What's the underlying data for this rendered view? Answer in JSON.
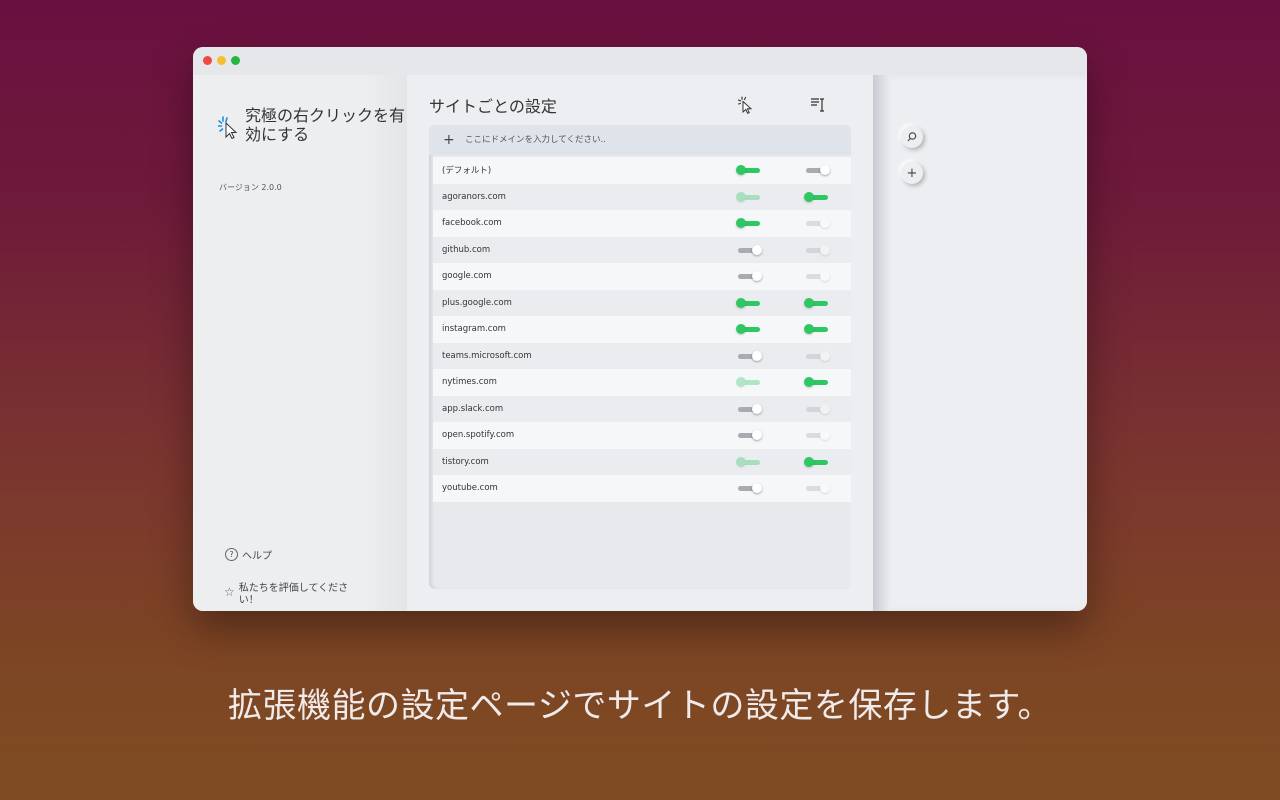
{
  "app": {
    "title": "究極の右クリックを有効にする",
    "version": "バージョン 2.0.0"
  },
  "sidebar": {
    "help_label": "ヘルプ",
    "help_icon": "?",
    "rate_label": "私たちを評価してください！",
    "rate_icon": "☆"
  },
  "main": {
    "title": "サイトごとの設定",
    "column_icons": [
      "cursor-click-icon",
      "text-select-icon"
    ],
    "add_placeholder": "ここにドメインを入力してください..",
    "add_icon": "+",
    "sites": [
      {
        "domain": "(デフォルト)",
        "toggle1": "on",
        "toggle2": "off"
      },
      {
        "domain": "agoranors.com",
        "toggle1": "on-dim",
        "toggle2": "on"
      },
      {
        "domain": "facebook.com",
        "toggle1": "on",
        "toggle2": "off-dim"
      },
      {
        "domain": "github.com",
        "toggle1": "off",
        "toggle2": "off-dim"
      },
      {
        "domain": "google.com",
        "toggle1": "off",
        "toggle2": "off-dim"
      },
      {
        "domain": "plus.google.com",
        "toggle1": "on",
        "toggle2": "on"
      },
      {
        "domain": "instagram.com",
        "toggle1": "on",
        "toggle2": "on"
      },
      {
        "domain": "teams.microsoft.com",
        "toggle1": "off",
        "toggle2": "off-dim"
      },
      {
        "domain": "nytimes.com",
        "toggle1": "on-dim",
        "toggle2": "on"
      },
      {
        "domain": "app.slack.com",
        "toggle1": "off",
        "toggle2": "off-dim"
      },
      {
        "domain": "open.spotify.com",
        "toggle1": "off",
        "toggle2": "off-dim"
      },
      {
        "domain": "tistory.com",
        "toggle1": "on-dim",
        "toggle2": "on"
      },
      {
        "domain": "youtube.com",
        "toggle1": "off",
        "toggle2": "off-dim"
      }
    ]
  },
  "right_panel": {
    "search_icon": "⚲",
    "add_icon": "+"
  },
  "caption": "拡張機能の設定ページでサイトの設定を保存します。",
  "colors": {
    "toggle_on": "#2fc764",
    "toggle_off": "#a8abb1",
    "accent_logo": "#1e8fe0"
  }
}
